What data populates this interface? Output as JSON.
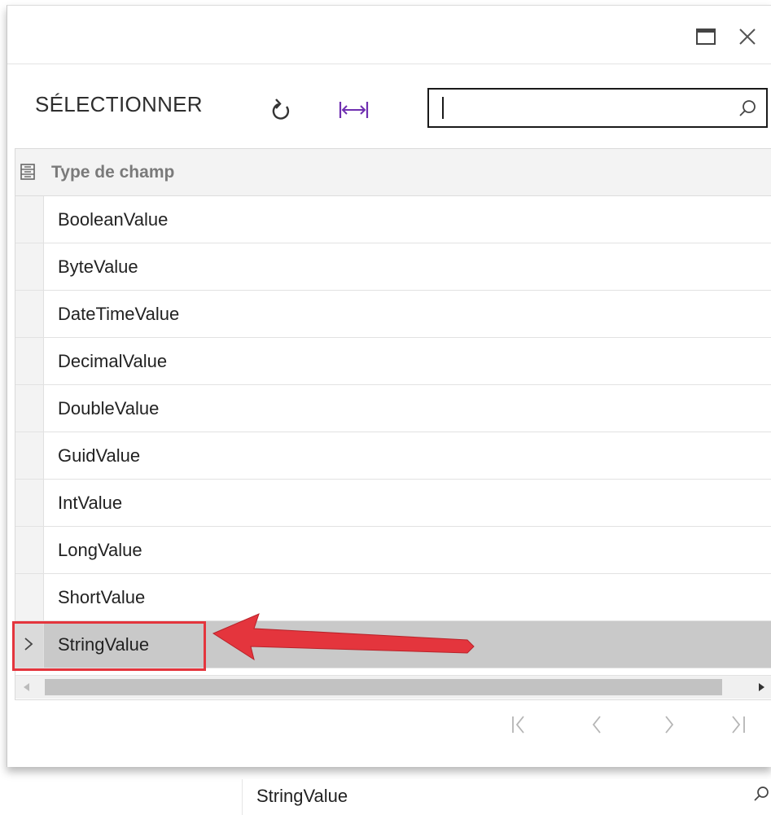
{
  "toolbar": {
    "select_label": "SÉLECTIONNER",
    "refresh_icon": "refresh-icon",
    "fit_icon": "fit-columns-icon",
    "search_value": "",
    "search_icon": "search-icon"
  },
  "window": {
    "maximize_icon": "maximize-icon",
    "close_icon": "close-icon"
  },
  "grid": {
    "column_header": "Type de champ",
    "rows": [
      "BooleanValue",
      "ByteValue",
      "DateTimeValue",
      "DecimalValue",
      "DoubleValue",
      "GuidValue",
      "IntValue",
      "LongValue",
      "ShortValue",
      "StringValue"
    ],
    "selected_row_index": 9
  },
  "pager": {
    "icons": [
      "first-page-icon",
      "previous-page-icon",
      "next-page-icon",
      "last-page-icon"
    ]
  },
  "below_field": {
    "value": "StringValue"
  },
  "colors": {
    "highlight": "#e4353d",
    "selected_row": "#c9c9c9",
    "header_text": "#7a7a7a"
  }
}
